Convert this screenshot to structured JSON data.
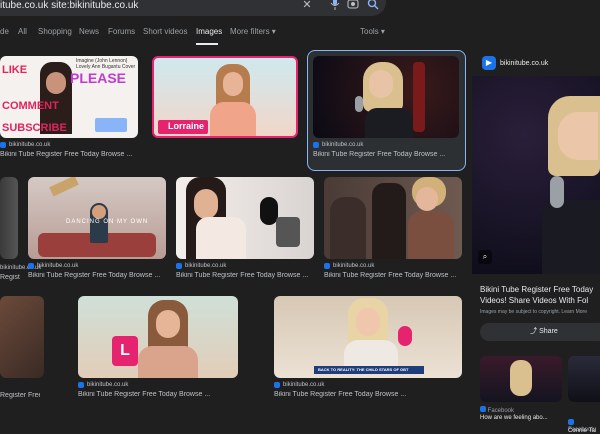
{
  "search": {
    "query": "itube.co.uk site:bikinitube.co.uk"
  },
  "icons": {
    "clear": "close-icon",
    "voice": "mic-icon",
    "lens": "camera-icon",
    "search": "search-icon"
  },
  "tabs": [
    {
      "label": "de"
    },
    {
      "label": "All"
    },
    {
      "label": "Shopping"
    },
    {
      "label": "News"
    },
    {
      "label": "Forums"
    },
    {
      "label": "Short videos"
    },
    {
      "label": "Images"
    },
    {
      "label": "More filters ▾"
    }
  ],
  "tools": "Tools ▾",
  "results": [
    {
      "site": "bikinitube.co.uk",
      "title": "Bikini Tube Register Free Today Browse ...",
      "overlay": [
        "LIKE",
        "PLEASE",
        "COMMENT",
        "SUBSCRIBE"
      ],
      "caption": "Imagine (John Lennon) Lovely Ann Bugantu Cover"
    },
    {
      "site": "",
      "title": "",
      "overlay": [
        "Lorraine"
      ]
    },
    {
      "site": "bikinitube.co.uk",
      "title": "Bikini Tube Register Free Today Browse ..."
    },
    {
      "site": "bikinitube.co.uk",
      "title": "Bikini Tube Register Free Today Browse ..."
    },
    {
      "site": "bikinitube.co.uk",
      "title": "Bikini Tube Register Free Today Browse ...",
      "caption": "DANCING ON MY OWN"
    },
    {
      "site": "bikinitube.co.uk",
      "title": "Bikini Tube Register Free Today Browse ..."
    },
    {
      "site": "bikinitube.co.uk",
      "title": "Bikini Tube Register Free Today Browse ..."
    },
    {
      "site": "bikinitube.co.uk",
      "title": "Bikini Tube Register Free Today Browse ..."
    },
    {
      "site": "bikinitube.co.uk",
      "title": "Bikini Tube Register Free Today Browse ...",
      "caption": "BACK TO REALITY: THE CHILD STARS OF GBT"
    }
  ],
  "left_edge": {
    "site": "bikinitube.co.uk",
    "title": "Register Free Today Browse ..."
  },
  "panel": {
    "site": "bikinitube.co.uk",
    "title": "Bikini Tube Register Free Today Videos! Share Videos With Fol",
    "note": "Images may be subject to copyright. Learn More",
    "share_label": "Share",
    "related": [
      {
        "site": "Facebook",
        "title": "How are we feeling abo..."
      },
      {
        "site": "Facebook",
        "title": "Connie Tal"
      }
    ]
  }
}
